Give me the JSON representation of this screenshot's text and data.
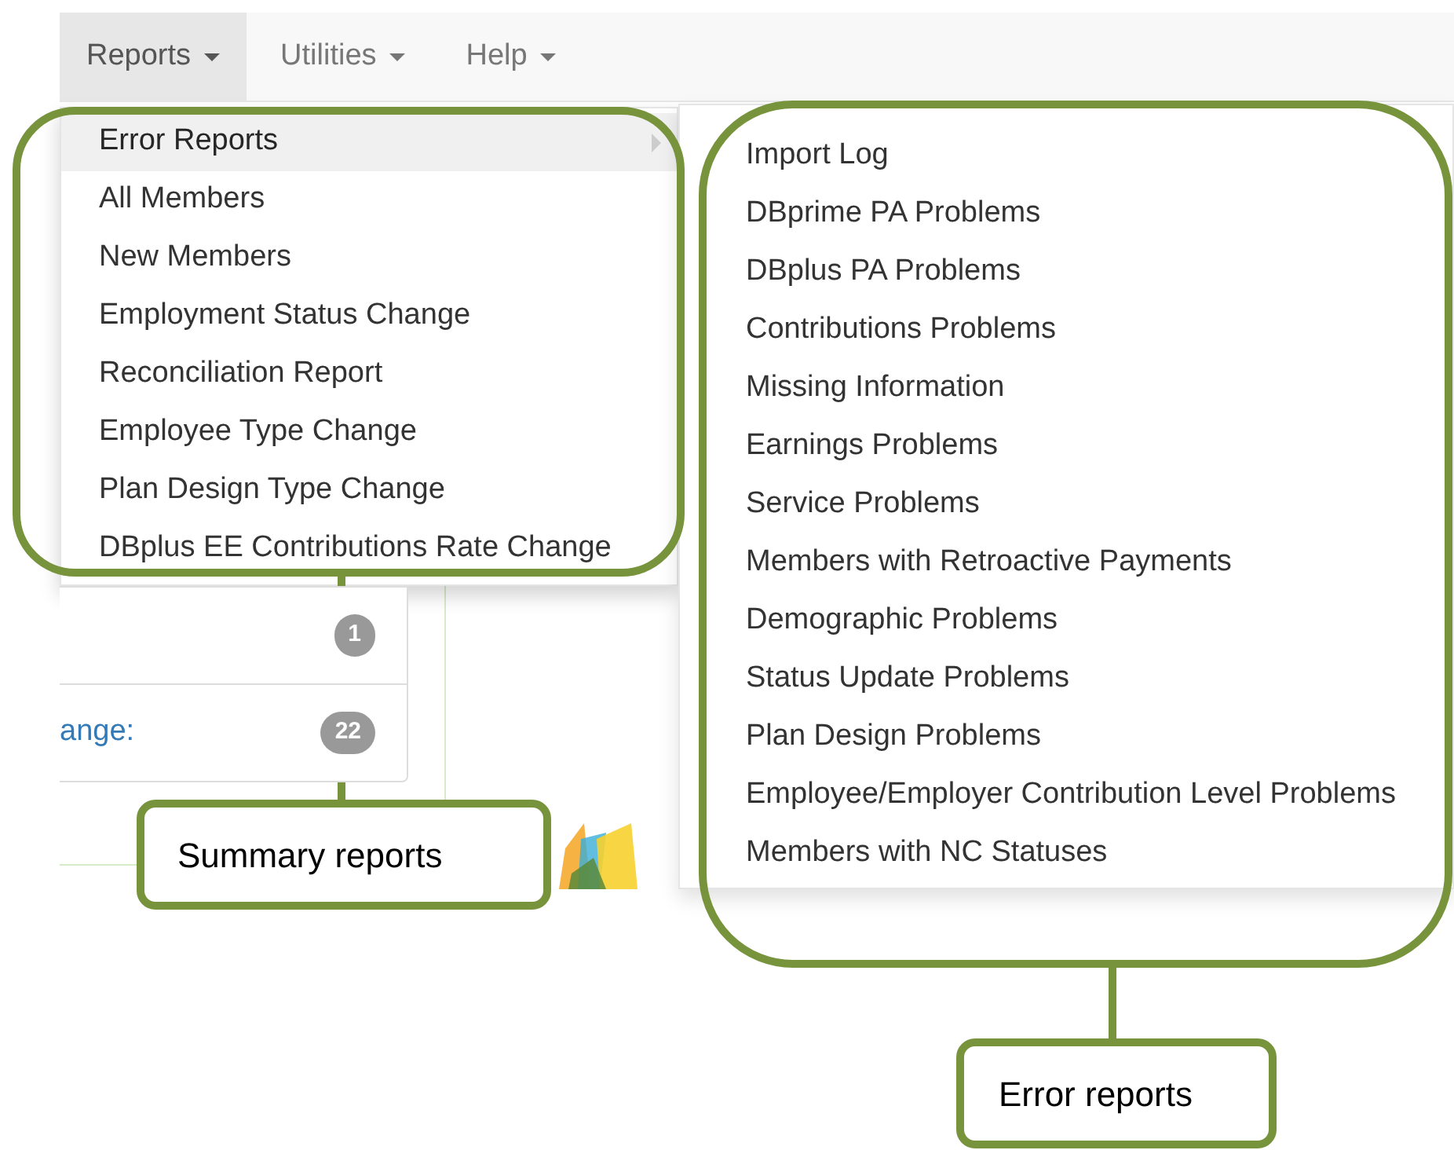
{
  "navbar": {
    "menus": [
      {
        "label": "Reports",
        "selected": true
      },
      {
        "label": "Utilities",
        "selected": false
      },
      {
        "label": "Help",
        "selected": false
      }
    ]
  },
  "reports_menu": {
    "items": [
      {
        "label": "Error Reports",
        "selected": true,
        "has_submenu": true
      },
      {
        "label": "All Members",
        "selected": false,
        "has_submenu": false
      },
      {
        "label": "New Members",
        "selected": false,
        "has_submenu": false
      },
      {
        "label": "Employment Status Change",
        "selected": false,
        "has_submenu": false
      },
      {
        "label": "Reconciliation Report",
        "selected": false,
        "has_submenu": false
      },
      {
        "label": "Employee Type Change",
        "selected": false,
        "has_submenu": false
      },
      {
        "label": "Plan Design Type Change",
        "selected": false,
        "has_submenu": false
      },
      {
        "label": "DBplus EE Contributions Rate Change",
        "selected": false,
        "has_submenu": false
      }
    ]
  },
  "error_reports_submenu": {
    "items": [
      "Import Log",
      "DBprime PA Problems",
      "DBplus PA Problems",
      "Contributions Problems",
      "Missing Information",
      "Earnings Problems",
      "Service Problems",
      "Members with Retroactive Payments",
      "Demographic Problems",
      "Status Update Problems",
      "Plan Design Problems",
      "Employee/Employer Contribution Level Problems",
      "Members with NC Statuses"
    ]
  },
  "background_panel": {
    "rows": [
      {
        "badge": "1"
      },
      {
        "link": "ange:",
        "badge": "22"
      }
    ]
  },
  "annotations": [
    {
      "label": "Summary reports"
    },
    {
      "label": "Error reports"
    }
  ]
}
